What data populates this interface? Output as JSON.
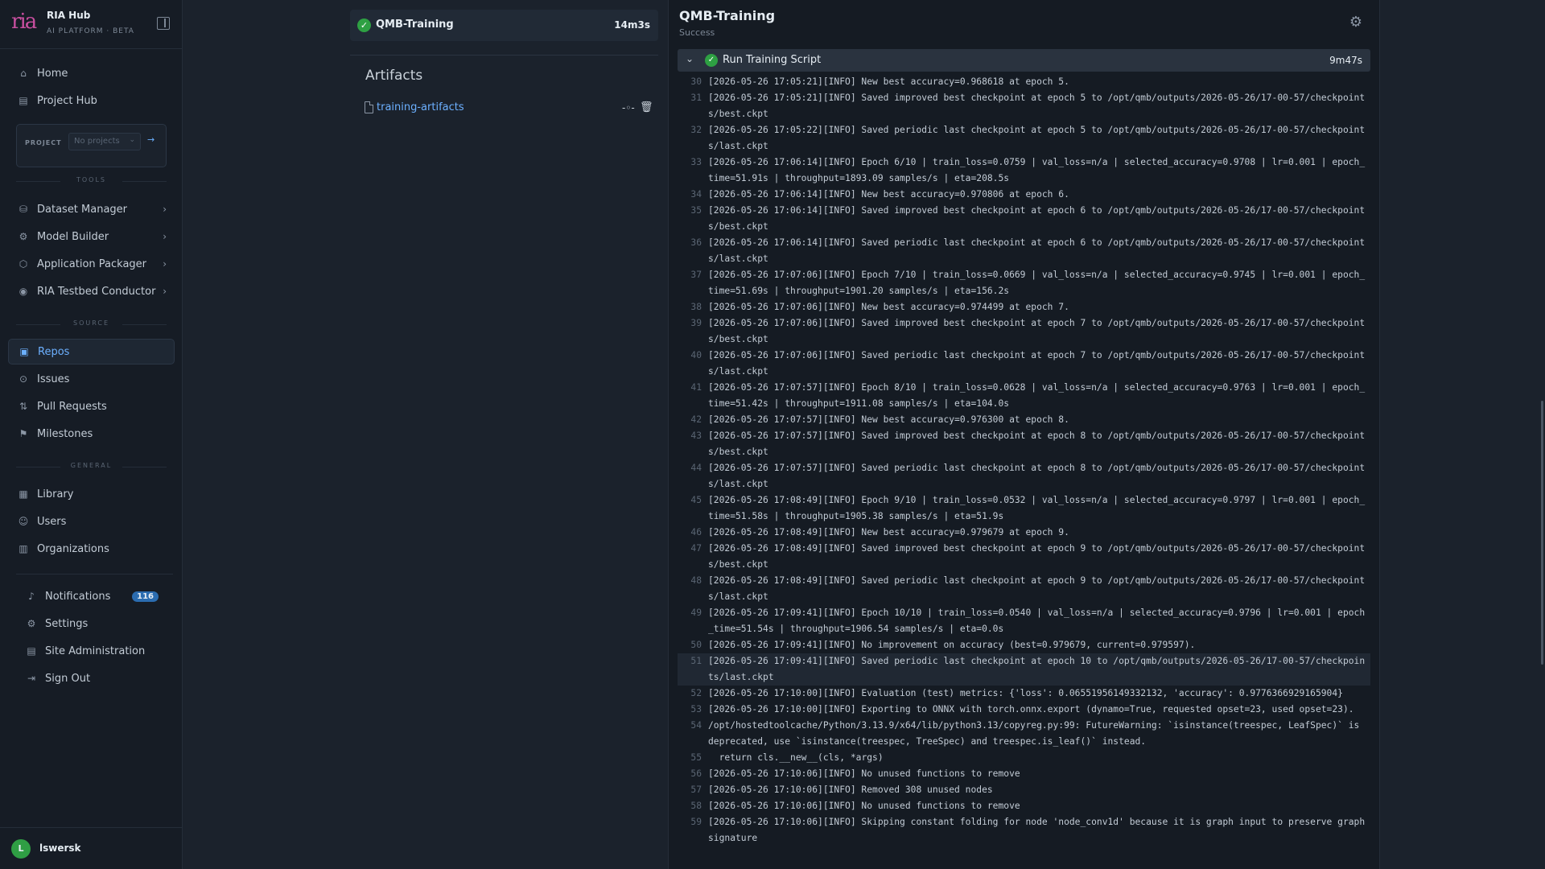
{
  "brand": {
    "title": "RIA Hub",
    "subtitle": "AI PLATFORM · BETA",
    "logo": "ria"
  },
  "nav_top": [
    {
      "label": "Home",
      "icon": "home-icon"
    },
    {
      "label": "Project Hub",
      "icon": "book-icon"
    }
  ],
  "project": {
    "label": "PROJECT",
    "placeholder": "No projects",
    "go": "→"
  },
  "sections": {
    "tools": "TOOLS",
    "source": "SOURCE",
    "general": "GENERAL"
  },
  "tools": [
    {
      "label": "Dataset Manager",
      "icon": "database-icon"
    },
    {
      "label": "Model Builder",
      "icon": "cog-icon"
    },
    {
      "label": "Application Packager",
      "icon": "package-icon"
    },
    {
      "label": "RIA Testbed Conductor",
      "icon": "antenna-icon"
    }
  ],
  "source": [
    {
      "label": "Repos",
      "icon": "repo-icon",
      "active": true
    },
    {
      "label": "Issues",
      "icon": "issue-icon"
    },
    {
      "label": "Pull Requests",
      "icon": "pull-request-icon"
    },
    {
      "label": "Milestones",
      "icon": "milestone-icon"
    }
  ],
  "general": [
    {
      "label": "Library",
      "icon": "grid-icon"
    },
    {
      "label": "Users",
      "icon": "user-icon"
    },
    {
      "label": "Organizations",
      "icon": "building-icon"
    }
  ],
  "account": {
    "notifications": {
      "label": "Notifications",
      "count": "116"
    },
    "settings": "Settings",
    "site_admin": "Site Administration",
    "sign_out": "Sign Out"
  },
  "user": {
    "initial": "L",
    "name": "lswersk"
  },
  "job": {
    "name": "QMB-Training",
    "duration": "14m3s",
    "status_color": "#2ea043"
  },
  "artifacts": {
    "title": "Artifacts",
    "items": [
      {
        "name": "training-artifacts"
      }
    ]
  },
  "run": {
    "title": "QMB-Training",
    "status": "Success",
    "step": {
      "name": "Run Training Script",
      "duration": "9m47s"
    },
    "log_lines": [
      {
        "n": "30",
        "t": "[2026-05-26 17:05:21][INFO] New best accuracy=0.968618 at epoch 5."
      },
      {
        "n": "31",
        "t": "[2026-05-26 17:05:21][INFO] Saved improved best checkpoint at epoch 5 to /opt/qmb/outputs/2026-05-26/17-00-57/checkpoints/best.ckpt"
      },
      {
        "n": "32",
        "t": "[2026-05-26 17:05:22][INFO] Saved periodic last checkpoint at epoch 5 to /opt/qmb/outputs/2026-05-26/17-00-57/checkpoints/last.ckpt"
      },
      {
        "n": "33",
        "t": "[2026-05-26 17:06:14][INFO] Epoch 6/10 | train_loss=0.0759 | val_loss=n/a | selected_accuracy=0.9708 | lr=0.001 | epoch_time=51.91s | throughput=1893.09 samples/s | eta=208.5s"
      },
      {
        "n": "34",
        "t": "[2026-05-26 17:06:14][INFO] New best accuracy=0.970806 at epoch 6."
      },
      {
        "n": "35",
        "t": "[2026-05-26 17:06:14][INFO] Saved improved best checkpoint at epoch 6 to /opt/qmb/outputs/2026-05-26/17-00-57/checkpoints/best.ckpt"
      },
      {
        "n": "36",
        "t": "[2026-05-26 17:06:14][INFO] Saved periodic last checkpoint at epoch 6 to /opt/qmb/outputs/2026-05-26/17-00-57/checkpoints/last.ckpt"
      },
      {
        "n": "37",
        "t": "[2026-05-26 17:07:06][INFO] Epoch 7/10 | train_loss=0.0669 | val_loss=n/a | selected_accuracy=0.9745 | lr=0.001 | epoch_time=51.69s | throughput=1901.20 samples/s | eta=156.2s"
      },
      {
        "n": "38",
        "t": "[2026-05-26 17:07:06][INFO] New best accuracy=0.974499 at epoch 7."
      },
      {
        "n": "39",
        "t": "[2026-05-26 17:07:06][INFO] Saved improved best checkpoint at epoch 7 to /opt/qmb/outputs/2026-05-26/17-00-57/checkpoints/best.ckpt"
      },
      {
        "n": "40",
        "t": "[2026-05-26 17:07:06][INFO] Saved periodic last checkpoint at epoch 7 to /opt/qmb/outputs/2026-05-26/17-00-57/checkpoints/last.ckpt"
      },
      {
        "n": "41",
        "t": "[2026-05-26 17:07:57][INFO] Epoch 8/10 | train_loss=0.0628 | val_loss=n/a | selected_accuracy=0.9763 | lr=0.001 | epoch_time=51.42s | throughput=1911.08 samples/s | eta=104.0s"
      },
      {
        "n": "42",
        "t": "[2026-05-26 17:07:57][INFO] New best accuracy=0.976300 at epoch 8."
      },
      {
        "n": "43",
        "t": "[2026-05-26 17:07:57][INFO] Saved improved best checkpoint at epoch 8 to /opt/qmb/outputs/2026-05-26/17-00-57/checkpoints/best.ckpt"
      },
      {
        "n": "44",
        "t": "[2026-05-26 17:07:57][INFO] Saved periodic last checkpoint at epoch 8 to /opt/qmb/outputs/2026-05-26/17-00-57/checkpoints/last.ckpt"
      },
      {
        "n": "45",
        "t": "[2026-05-26 17:08:49][INFO] Epoch 9/10 | train_loss=0.0532 | val_loss=n/a | selected_accuracy=0.9797 | lr=0.001 | epoch_time=51.58s | throughput=1905.38 samples/s | eta=51.9s"
      },
      {
        "n": "46",
        "t": "[2026-05-26 17:08:49][INFO] New best accuracy=0.979679 at epoch 9."
      },
      {
        "n": "47",
        "t": "[2026-05-26 17:08:49][INFO] Saved improved best checkpoint at epoch 9 to /opt/qmb/outputs/2026-05-26/17-00-57/checkpoints/best.ckpt"
      },
      {
        "n": "48",
        "t": "[2026-05-26 17:08:49][INFO] Saved periodic last checkpoint at epoch 9 to /opt/qmb/outputs/2026-05-26/17-00-57/checkpoints/last.ckpt"
      },
      {
        "n": "49",
        "t": "[2026-05-26 17:09:41][INFO] Epoch 10/10 | train_loss=0.0540 | val_loss=n/a | selected_accuracy=0.9796 | lr=0.001 | epoch_time=51.54s | throughput=1906.54 samples/s | eta=0.0s"
      },
      {
        "n": "50",
        "t": "[2026-05-26 17:09:41][INFO] No improvement on accuracy (best=0.979679, current=0.979597)."
      },
      {
        "n": "51",
        "t": "[2026-05-26 17:09:41][INFO] Saved periodic last checkpoint at epoch 10 to /opt/qmb/outputs/2026-05-26/17-00-57/checkpoints/last.ckpt",
        "highlight": true
      },
      {
        "n": "52",
        "t": "[2026-05-26 17:10:00][INFO] Evaluation (test) metrics: {'loss': 0.06551956149332132, 'accuracy': 0.9776366929165904}"
      },
      {
        "n": "53",
        "t": "[2026-05-26 17:10:00][INFO] Exporting to ONNX with torch.onnx.export (dynamo=True, requested opset=23, used opset=23)."
      },
      {
        "n": "54",
        "t": "/opt/hostedtoolcache/Python/3.13.9/x64/lib/python3.13/copyreg.py:99: FutureWarning: `isinstance(treespec, LeafSpec)` is deprecated, use `isinstance(treespec, TreeSpec) and treespec.is_leaf()` instead."
      },
      {
        "n": "55",
        "t": "  return cls.__new__(cls, *args)"
      },
      {
        "n": "56",
        "t": "[2026-05-26 17:10:06][INFO] No unused functions to remove"
      },
      {
        "n": "57",
        "t": "[2026-05-26 17:10:06][INFO] Removed 308 unused nodes"
      },
      {
        "n": "58",
        "t": "[2026-05-26 17:10:06][INFO] No unused functions to remove"
      },
      {
        "n": "59",
        "t": "[2026-05-26 17:10:06][INFO] Skipping constant folding for node 'node_conv1d' because it is graph input to preserve graph signature"
      }
    ]
  }
}
